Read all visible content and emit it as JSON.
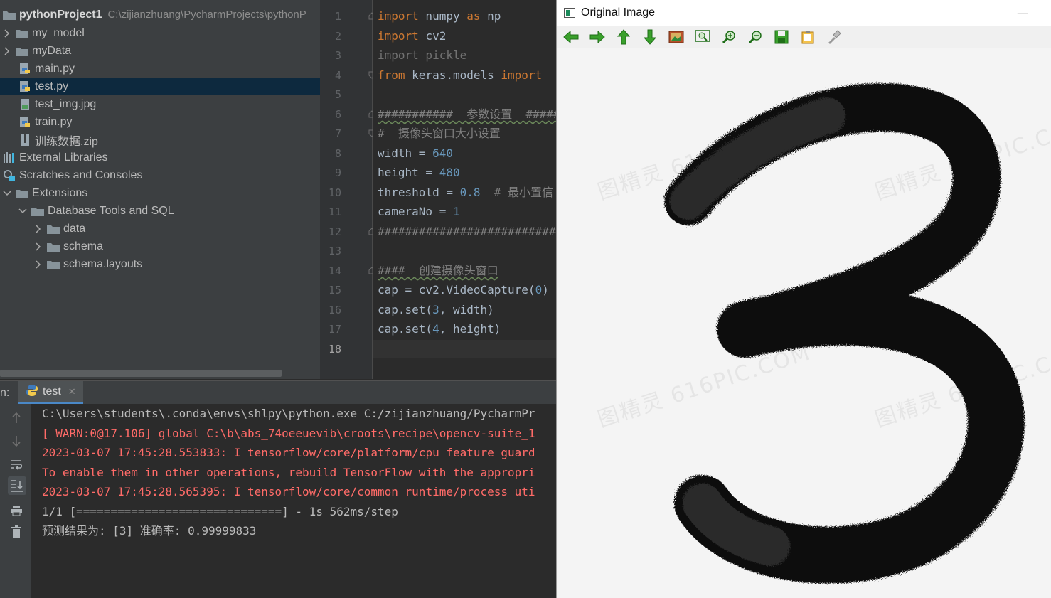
{
  "project": {
    "root_name": "pythonProject1",
    "root_path": "C:\\zijianzhuang\\PycharmProjects\\pythonP",
    "items": [
      {
        "label": "my_model"
      },
      {
        "label": "myData"
      },
      {
        "label": "main.py"
      },
      {
        "label": "test.py"
      },
      {
        "label": "test_img.jpg"
      },
      {
        "label": "train.py"
      },
      {
        "label": "训练数据.zip"
      },
      {
        "label": "External Libraries"
      },
      {
        "label": "Scratches and Consoles"
      },
      {
        "label": "Extensions"
      },
      {
        "label": "Database Tools and SQL"
      },
      {
        "label": "data"
      },
      {
        "label": "schema"
      },
      {
        "label": "schema.layouts"
      }
    ]
  },
  "editor": {
    "line_numbers": [
      "1",
      "2",
      "3",
      "4",
      "5",
      "6",
      "7",
      "8",
      "9",
      "10",
      "11",
      "12",
      "13",
      "14",
      "15",
      "16",
      "17",
      "18"
    ],
    "lines": {
      "l1_kw": "import",
      "l1_rest": " numpy ",
      "l1_as": "as",
      "l1_np": " np",
      "l2_kw": "import",
      "l2_rest": " cv2",
      "l3": "import pickle",
      "l4_from": "from",
      "l4_mod": " keras.models ",
      "l4_import": "import",
      "l6": "###########  参数设置  ######",
      "l7": "#  摄像头窗口大小设置",
      "l8_a": "width = ",
      "l8_b": "640",
      "l9_a": "height = ",
      "l9_b": "480",
      "l10_a": "threshold = ",
      "l10_b": "0.8",
      "l10_c": "  # 最小置信",
      "l11_a": "cameraNo = ",
      "l11_b": "1",
      "l12": "##############################",
      "l14": "####  创建摄像头窗口",
      "l15_a": "cap = cv2.VideoCapture(",
      "l15_b": "0",
      "l15_c": ")",
      "l16_a": "cap.set(",
      "l16_b": "3",
      "l16_c": ", width)",
      "l17_a": "cap.set(",
      "l17_b": "4",
      "l17_c": ", height)"
    }
  },
  "run": {
    "label": "n:",
    "tab_label": "test",
    "console": [
      "C:\\Users\\students\\.conda\\envs\\shlpy\\python.exe C:/zijianzhuang/PycharmPr",
      "[ WARN:0@17.106] global C:\\b\\abs_74oeeuevib\\croots\\recipe\\opencv-suite_1",
      "2023-03-07 17:45:28.553833: I tensorflow/core/platform/cpu_feature_guard",
      "To enable them in other operations, rebuild TensorFlow with the appropri",
      "2023-03-07 17:45:28.565395: I tensorflow/core/common_runtime/process_uti",
      "1/1 [==============================] - 1s 562ms/step",
      "预测结果为: [3] 准确率: 0.99999833"
    ]
  },
  "image_window": {
    "title": "Original Image",
    "minimize_glyph": "—",
    "watermark": "图精灵 616PIC.COM",
    "toolbar_icons": [
      "arrow-left-icon",
      "arrow-right-icon",
      "arrow-up-icon",
      "arrow-down-icon",
      "image-icon",
      "zoom-fit-icon",
      "zoom-in-icon",
      "zoom-out-icon",
      "save-icon",
      "copy-icon",
      "properties-icon"
    ]
  }
}
